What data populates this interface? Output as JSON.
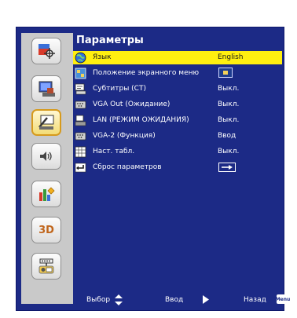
{
  "menu": {
    "title": "Параметры"
  },
  "sidebar": {
    "categories": [
      {
        "icon": "picture-icon"
      },
      {
        "icon": "screen-icon"
      },
      {
        "icon": "settings-icon",
        "active": true
      },
      {
        "icon": "volume-icon"
      },
      {
        "icon": "options-icon"
      },
      {
        "icon": "3d-icon",
        "label": "3D"
      },
      {
        "icon": "lan-icon"
      }
    ]
  },
  "settings": [
    {
      "label": "Язык",
      "value": "English",
      "icon": "globe-icon"
    },
    {
      "label": "Положение экранного меню",
      "value": "",
      "icon": "menu-position-icon"
    },
    {
      "label": "Субтитры (СТ)",
      "value": "Выкл.",
      "icon": "closed-caption-icon"
    },
    {
      "label": "VGA Out (Ожидание)",
      "value": "Выкл.",
      "icon": "vga-out-icon"
    },
    {
      "label": "LAN (РЕЖИМ ОЖИДАНИЯ)",
      "value": "Выкл.",
      "icon": "lan-standby-icon"
    },
    {
      "label": "VGA-2 (Функция)",
      "value": "Ввод",
      "icon": "vga2-icon"
    },
    {
      "label": "Наст. табл.",
      "value": "Выкл.",
      "icon": "test-pattern-icon"
    },
    {
      "label": "Сброс параметров",
      "value": "",
      "icon": "reset-icon"
    }
  ],
  "footer": {
    "select_label": "Выбор",
    "enter_label": "Ввод",
    "back_label": "Назад",
    "menu_key": "Menu"
  },
  "colors": {
    "background": "#1c2a86",
    "highlight": "#ffef10",
    "sidebar": "#c9c9c9"
  }
}
